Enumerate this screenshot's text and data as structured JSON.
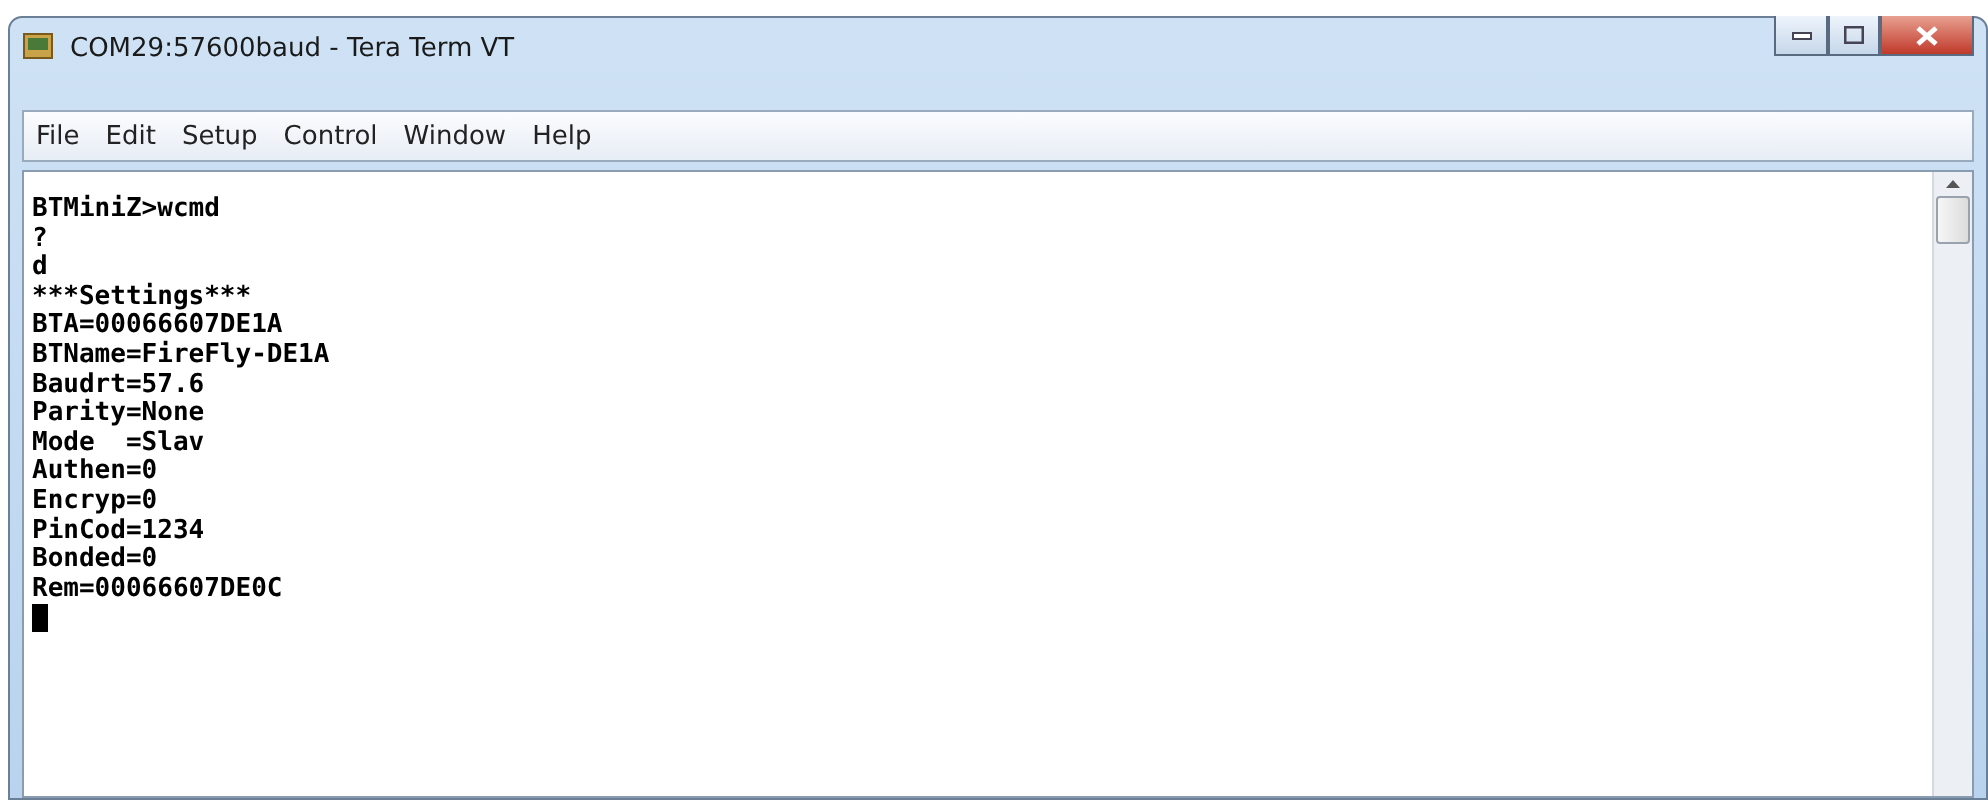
{
  "window": {
    "title": "COM29:57600baud - Tera Term VT"
  },
  "menu": [
    "File",
    "Edit",
    "Setup",
    "Control",
    "Window",
    "Help"
  ],
  "terminal": {
    "lines": [
      "BTMiniZ>wcmd",
      "?",
      "d",
      "***Settings***",
      "BTA=00066607DE1A",
      "BTName=FireFly-DE1A",
      "Baudrt=57.6",
      "Parity=None",
      "Mode  =Slav",
      "Authen=0",
      "Encryp=0",
      "PinCod=1234",
      "Bonded=0",
      "Rem=00066607DE0C"
    ],
    "cursor": true
  }
}
